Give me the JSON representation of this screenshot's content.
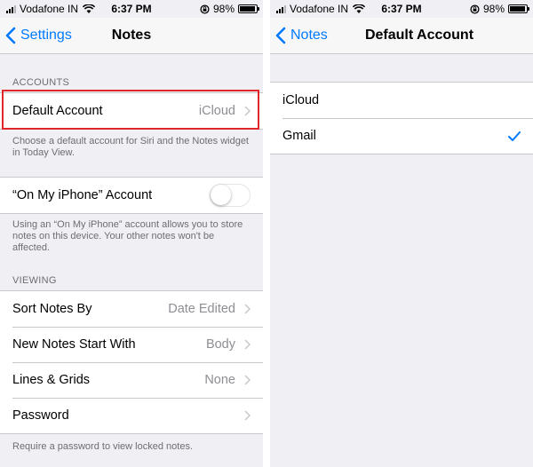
{
  "colors": {
    "accent": "#007aff",
    "highlight": "#e0262a",
    "background": "#efeff4"
  },
  "status_bar": {
    "carrier": "Vodafone IN",
    "time": "6:37 PM",
    "battery": "98%"
  },
  "left": {
    "nav": {
      "back_label": "Settings",
      "title": "Notes"
    },
    "accounts_header": "ACCOUNTS",
    "default_account": {
      "label": "Default Account",
      "value": "iCloud"
    },
    "default_footer": "Choose a default account for Siri and the Notes widget in Today View.",
    "on_my_iphone": {
      "label": "“On My iPhone” Account",
      "enabled": false
    },
    "on_my_iphone_footer": "Using an “On My iPhone” account allows you to store notes on this device. Your other notes won't be affected.",
    "viewing_header": "VIEWING",
    "viewing_rows": [
      {
        "label": "Sort Notes By",
        "value": "Date Edited"
      },
      {
        "label": "New Notes Start With",
        "value": "Body"
      },
      {
        "label": "Lines & Grids",
        "value": "None"
      },
      {
        "label": "Password",
        "value": ""
      }
    ],
    "password_footer": "Require a password to view locked notes."
  },
  "right": {
    "nav": {
      "back_label": "Notes",
      "title": "Default Account"
    },
    "options": [
      {
        "label": "iCloud",
        "selected": false
      },
      {
        "label": "Gmail",
        "selected": true
      }
    ]
  },
  "icons": [
    "signal-icon",
    "wifi-icon",
    "orientation-lock-icon",
    "battery-icon",
    "back-chevron-icon",
    "chevron-right-icon",
    "checkmark-icon"
  ]
}
